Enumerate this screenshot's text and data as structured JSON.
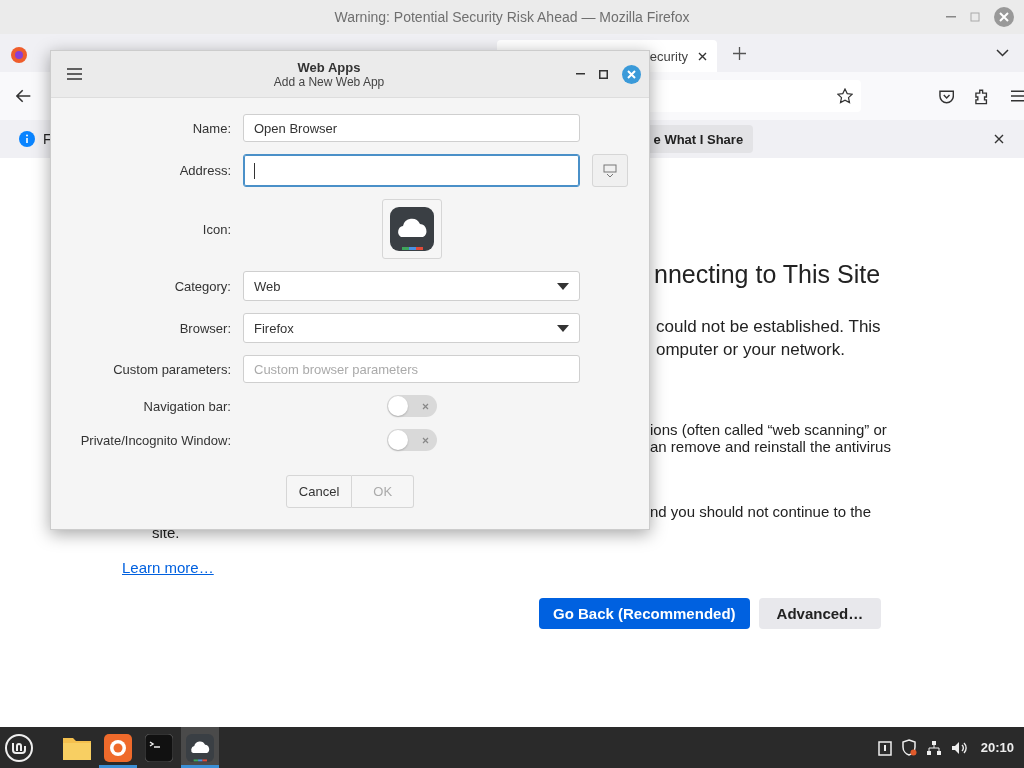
{
  "firefox": {
    "title": "Warning: Potential Security Risk Ahead — Mozilla Firefox",
    "tabs": [
      {
        "label": "ecurity",
        "selected": true
      }
    ],
    "notification": {
      "text": "F",
      "button": "e What I Share"
    },
    "page": {
      "heading": "nnecting to This Site",
      "paragraphs": [
        [
          "could not be established. This",
          "omputer or your network."
        ],
        [
          "ions (often called “web scanning” or",
          "an remove and reinstall the antivirus"
        ],
        [
          "nd you should not continue to the"
        ]
      ],
      "tail": "site.",
      "link": "Learn more…",
      "buttons": [
        {
          "label": "Go Back (Recommended)",
          "primary": true
        },
        {
          "label": "Advanced…",
          "primary": false
        }
      ]
    }
  },
  "dialog": {
    "title": "Web Apps",
    "subtitle": "Add a New Web App",
    "rows": [
      {
        "kind": "text",
        "label": "Name:",
        "value": "Open Browser",
        "focused": false
      },
      {
        "kind": "address",
        "label": "Address:",
        "focused": true
      },
      {
        "kind": "icon",
        "label": "Icon:"
      },
      {
        "kind": "select",
        "label": "Category:",
        "value": "Web"
      },
      {
        "kind": "select",
        "label": "Browser:",
        "value": "Firefox"
      },
      {
        "kind": "text",
        "label": "Custom parameters:",
        "placeholder": "Custom browser parameters",
        "focused": false
      },
      {
        "kind": "toggle",
        "label": "Navigation bar:",
        "on": false
      },
      {
        "kind": "toggle",
        "label": "Private/Incognito Window:",
        "on": false
      }
    ],
    "buttons": [
      {
        "label": "Cancel",
        "disabled": false
      },
      {
        "label": "OK",
        "disabled": true
      }
    ]
  },
  "taskbar": {
    "apps": [
      {
        "kind": "files",
        "running": false,
        "active": false
      },
      {
        "kind": "browser",
        "running": true,
        "active": false
      },
      {
        "kind": "terminal",
        "running": false,
        "active": false
      },
      {
        "kind": "webapps",
        "running": true,
        "active": true
      }
    ],
    "clock": "20:10"
  }
}
